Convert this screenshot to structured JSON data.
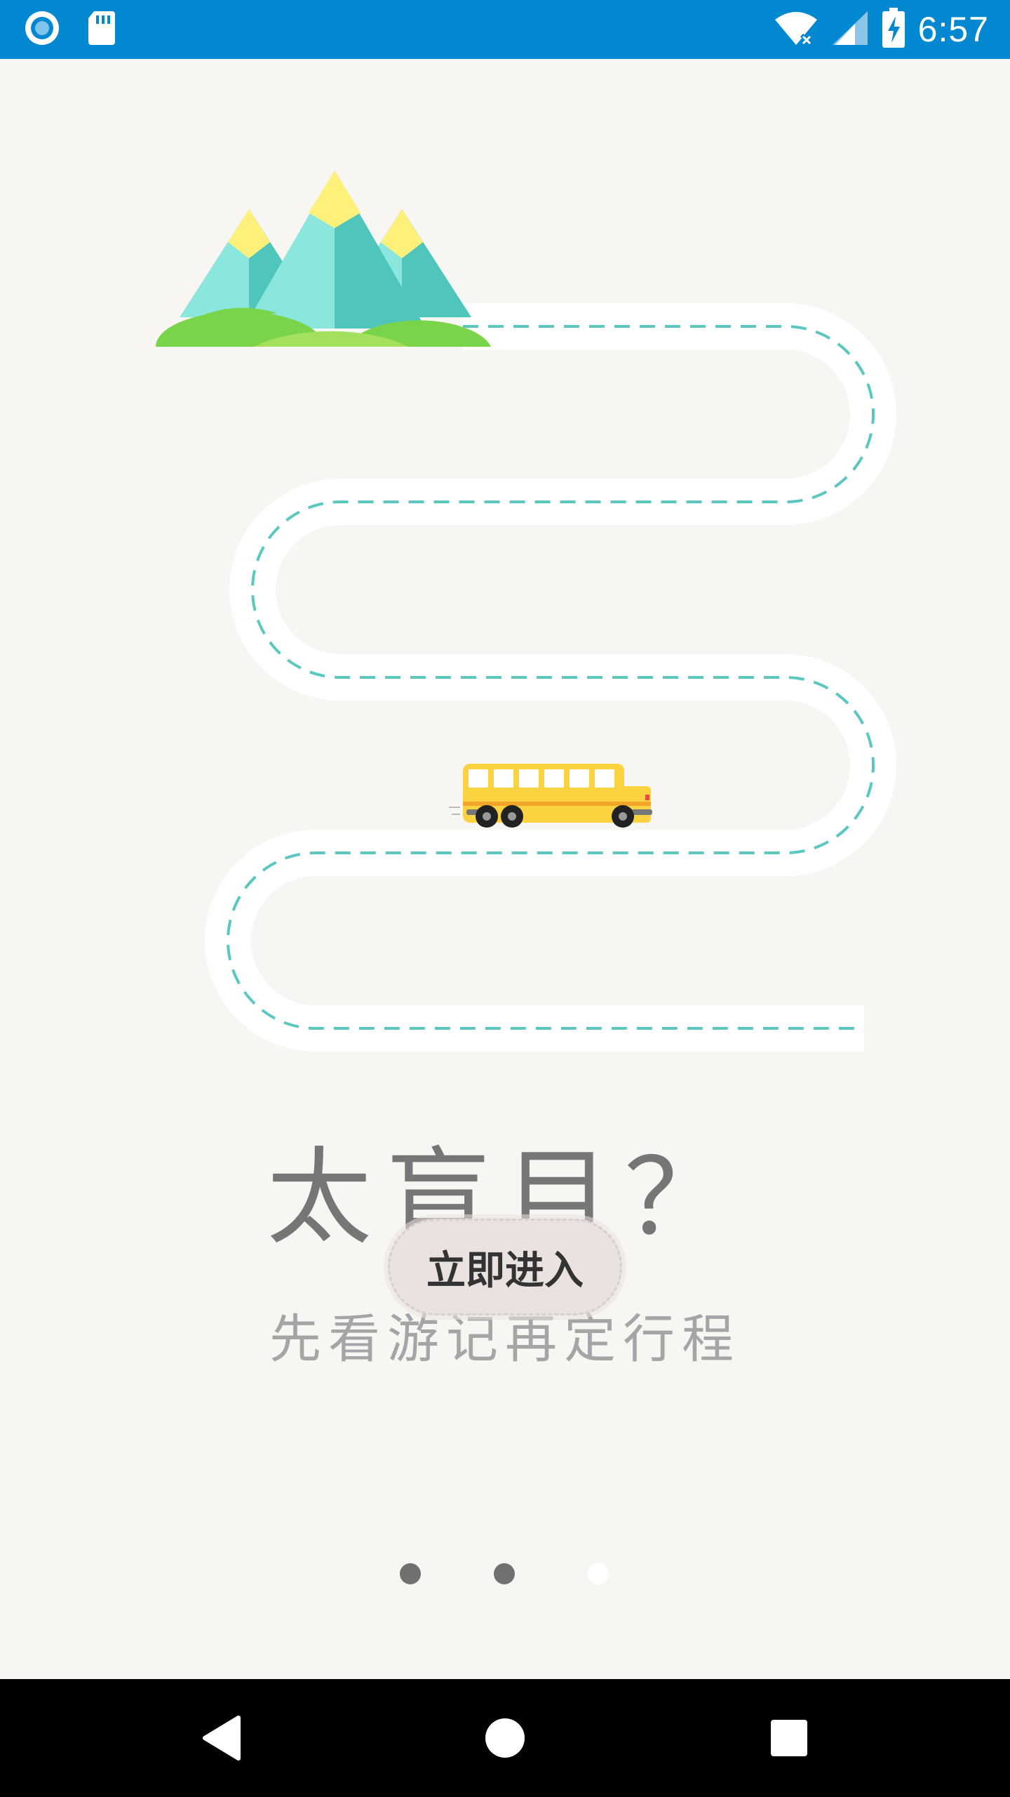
{
  "status_bar": {
    "time": "6:57",
    "background": "#0288d1",
    "icons": [
      "sync-icon",
      "sd-card-icon",
      "wifi-off-icon",
      "signal-icon",
      "battery-charging-icon"
    ]
  },
  "illustration": {
    "road_dash_color": "#5bc8c0",
    "bus_color": "#fbd23f",
    "mountain_colors": [
      "#8be7de",
      "#4fc5bb",
      "#fdf07b"
    ],
    "hill_colors": [
      "#79d44a",
      "#a2e05d"
    ]
  },
  "intro": {
    "headline": "太盲目？",
    "subline": "先看游记再定行程",
    "enter_button": "立即进入"
  },
  "pager": {
    "count": 3,
    "active_index": 2,
    "inactive_color": "#707070",
    "active_color": "#ffffff"
  },
  "nav_bar": {
    "buttons": [
      "back-icon",
      "home-icon",
      "recents-icon"
    ]
  }
}
